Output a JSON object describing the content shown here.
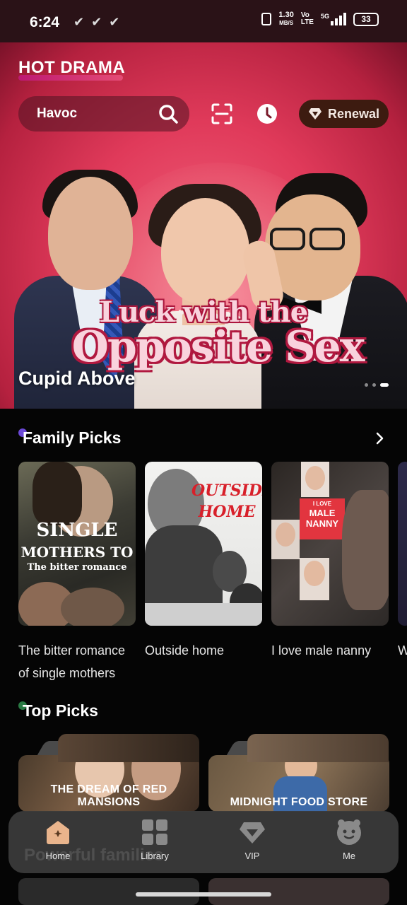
{
  "status_bar": {
    "time": "6:24",
    "net_speed_top": "1.30",
    "net_speed_unit": "MB/S",
    "lte_top": "Vo",
    "lte_bottom": "LTE",
    "network": "5G",
    "battery": "33"
  },
  "header": {
    "brand": "HOT DRAMA",
    "search_value": "Havoc",
    "renewal_label": "Renewal",
    "icons": [
      "search-icon",
      "scan-icon",
      "history-icon",
      "diamond-icon"
    ]
  },
  "hero": {
    "poster_line1": "Luck with the",
    "poster_line2": "Opposite Sex",
    "caption": "Cupid Above",
    "slide_count": 3,
    "active_slide": 3
  },
  "family_picks": {
    "title": "Family Picks",
    "items": [
      {
        "caption": "The bitter romance of single mothers",
        "poster_line1": "SINGLE",
        "poster_line2": "MOTHERS TO",
        "poster_line3": "The bitter romance"
      },
      {
        "caption": "Outside home",
        "poster_line1": "OUTSIDE",
        "poster_line2": "HOME"
      },
      {
        "caption": "I love male nanny",
        "poster_line1": "I LOVE",
        "poster_line2": "MALE",
        "poster_line3": "NANNY"
      },
      {
        "caption": "Wha"
      }
    ]
  },
  "top_picks": {
    "title": "Top Picks",
    "items": [
      {
        "label": "THE DREAM OF RED MANSIONS"
      },
      {
        "label": "MIDNIGHT FOOD STORE"
      }
    ]
  },
  "faded_section_title": "Powerful families",
  "bottom_nav": {
    "items": [
      {
        "label": "Home",
        "icon": "home-icon",
        "active": true
      },
      {
        "label": "Library",
        "icon": "library-icon",
        "active": false
      },
      {
        "label": "VIP",
        "icon": "vip-icon",
        "active": false
      },
      {
        "label": "Me",
        "icon": "me-icon",
        "active": false
      }
    ]
  },
  "colors": {
    "accent": "#e8507a",
    "renewal_bg": "#3d1b10",
    "nav_bg": "#3a3a3a"
  }
}
